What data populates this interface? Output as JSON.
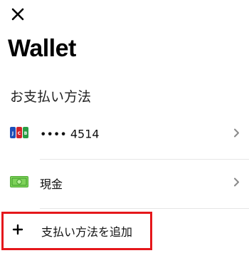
{
  "header": {
    "close_icon": "close-icon",
    "title": "Wallet"
  },
  "payment": {
    "section_title": "お支払い方法",
    "methods": [
      {
        "icon": "jcb-card-icon",
        "label": "•••• 4514"
      },
      {
        "icon": "cash-icon",
        "label": "現金"
      }
    ],
    "add_label": "支払い方法を追加"
  },
  "colors": {
    "highlight_border": "#e5171b",
    "cash_green": "#7ed25a"
  }
}
